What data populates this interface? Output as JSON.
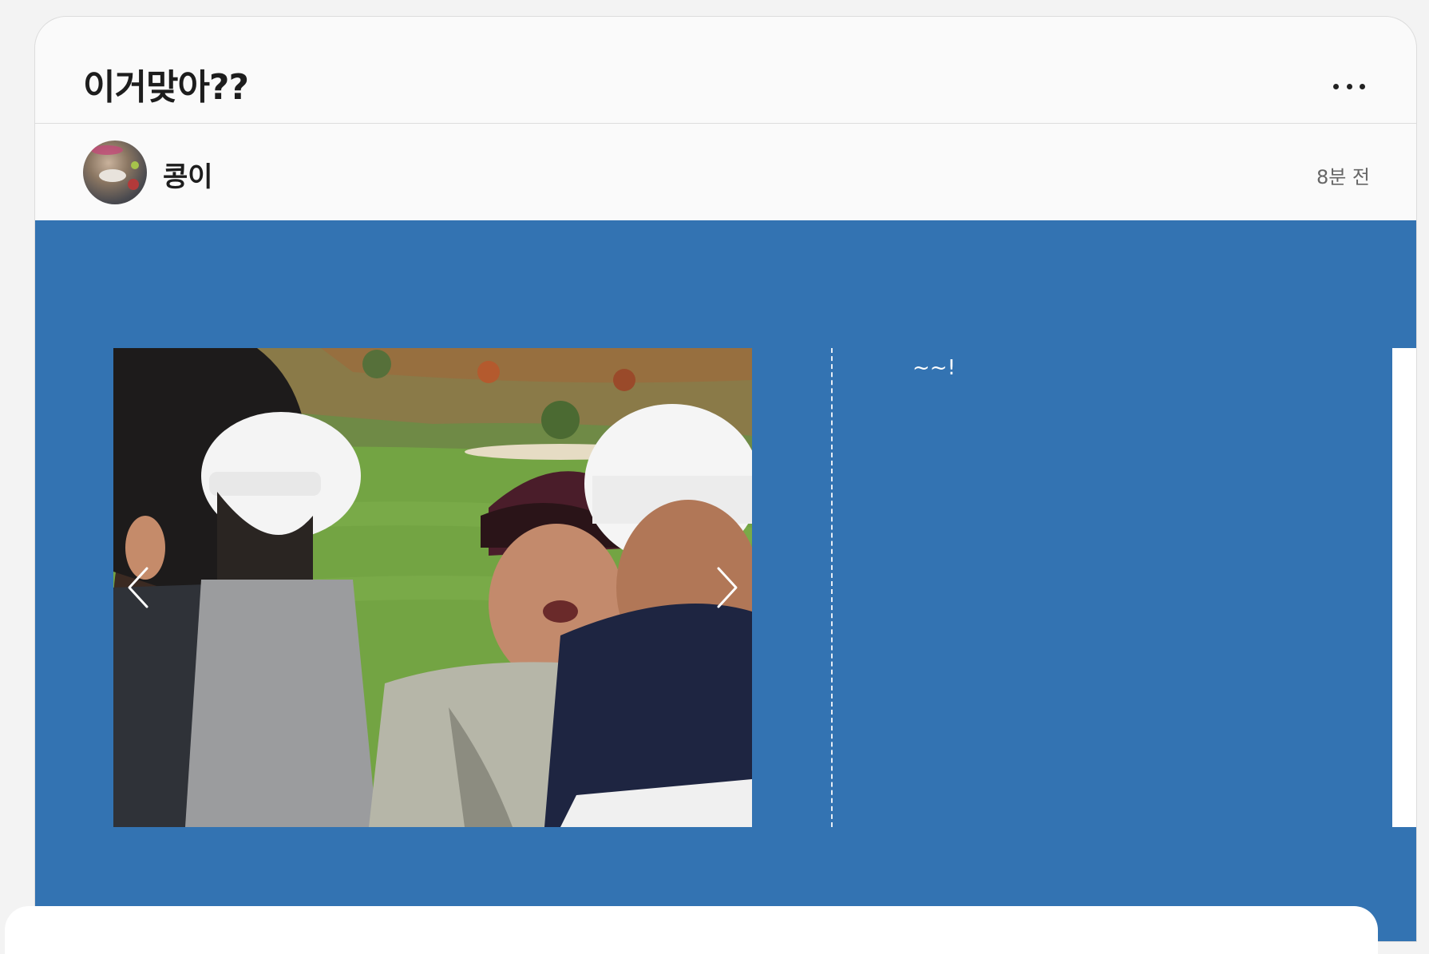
{
  "post": {
    "title": "이거맞아??",
    "author": "콩이",
    "time_ago": "8분 전",
    "caption": "~~!"
  },
  "icons": {
    "more": "more-horizontal-icon",
    "prev": "chevron-left-icon",
    "next": "chevron-right-icon"
  },
  "colors": {
    "content_bg": "#3373b2",
    "card_bg": "#fafafa",
    "page_bg": "#f3f3f3"
  },
  "carousel": {
    "image_alt": "Golfers talking on a green golf course"
  }
}
